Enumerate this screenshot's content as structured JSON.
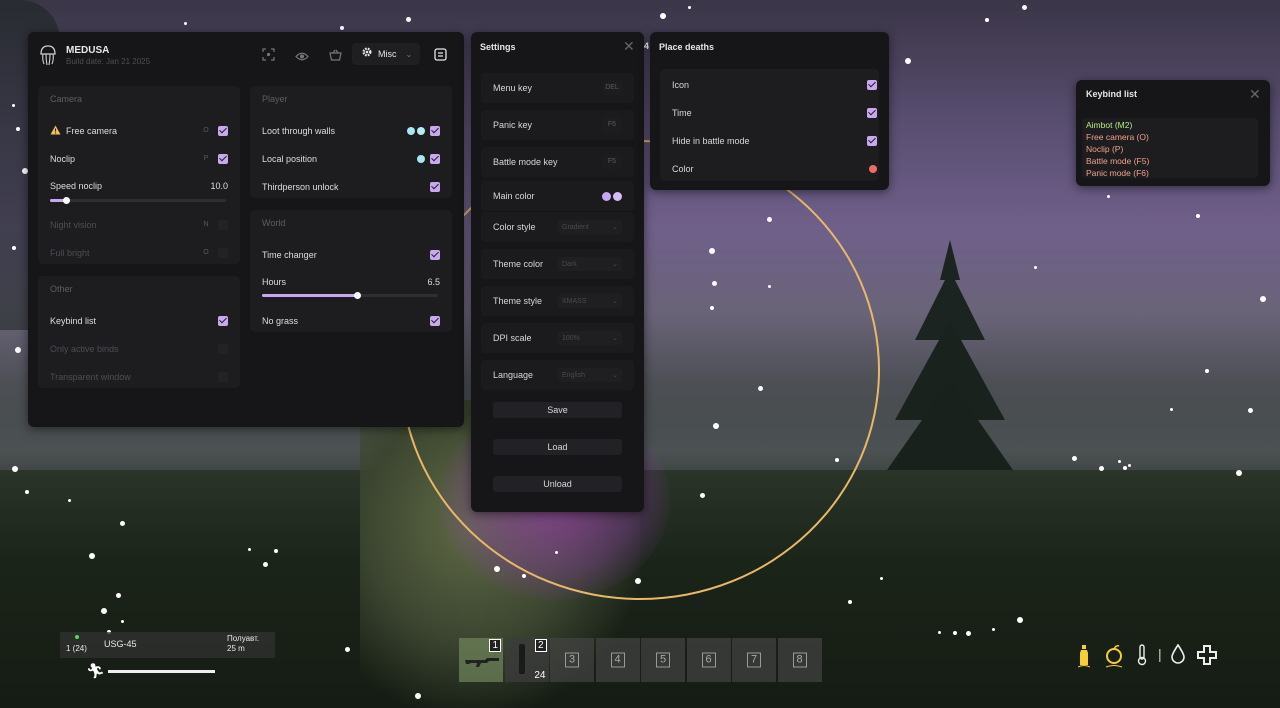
{
  "menu": {
    "app_name": "MEDUSA",
    "build_date": "Build date: Jan 21 2025",
    "toolbar": {
      "tab_label": "Misc"
    },
    "camera": {
      "title": "Camera",
      "free_camera": {
        "label": "Free camera",
        "key": "O"
      },
      "noclip": {
        "label": "Noclip",
        "key": "P"
      },
      "speed_noclip": {
        "label": "Speed noclip",
        "value": "10.0",
        "fraction": 0.09
      },
      "night_vision": {
        "label": "Night vision",
        "key": "N"
      },
      "full_bright": {
        "label": "Full bright",
        "key": "O"
      }
    },
    "other": {
      "title": "Other",
      "keybind_list": "Keybind list",
      "only_active_binds": "Only active binds",
      "transparent_window": "Transparent window"
    },
    "player": {
      "title": "Player",
      "loot_through_walls": "Loot through walls",
      "local_position": "Local position",
      "thirdperson_unlock": "Thirdperson unlock"
    },
    "world": {
      "title": "World",
      "time_changer": "Time changer",
      "hours": {
        "label": "Hours",
        "value": "6.5",
        "fraction": 0.54
      },
      "no_grass": "No grass"
    }
  },
  "settings": {
    "title": "Settings",
    "menu_key": {
      "label": "Menu key",
      "value": "DEL"
    },
    "panic_key": {
      "label": "Panic key",
      "value": "F6"
    },
    "battle_mode_key": {
      "label": "Battle mode key",
      "value": "F5"
    },
    "main_color": "Main color",
    "color_style": {
      "label": "Color style",
      "value": "Gradient"
    },
    "theme_color": {
      "label": "Theme color",
      "value": "Dark"
    },
    "theme_style": {
      "label": "Theme style",
      "value": "XMASS"
    },
    "dpi_scale": {
      "label": "DPI scale",
      "value": "100%"
    },
    "language": {
      "label": "Language",
      "value": "English"
    },
    "save": "Save",
    "load": "Load",
    "unload": "Unload"
  },
  "place_deaths": {
    "title": "Place deaths",
    "icon": "Icon",
    "time": "Time",
    "hide_in_battle_mode": "Hide in battle mode",
    "color": "Color"
  },
  "keybind_list": {
    "title": "Keybind list",
    "items": [
      {
        "label": "Aimbot (M2)",
        "color": "#b8e986"
      },
      {
        "label": "Free camera (O)",
        "color": "#f2a08a"
      },
      {
        "label": "Noclip (P)",
        "color": "#f2a08a"
      },
      {
        "label": "Battle mode (F5)",
        "color": "#f2a08a"
      },
      {
        "label": "Panic mode (F6)",
        "color": "#f2a08a"
      }
    ]
  },
  "hud": {
    "ammo": "1 (24)",
    "weapon": "USG-45",
    "fire_mode": "Полуавт.",
    "range": "25 m",
    "stray_digit": "4",
    "slots": [
      "1",
      "2",
      "3",
      "4",
      "5",
      "6",
      "7",
      "8"
    ],
    "slot2_count": "24",
    "stamina_fraction": 1.0
  },
  "colors": {
    "accent": "#c9a8f0",
    "accent_cyan": "#a8e6f0",
    "death_color": "#f06a6a",
    "circle": "#e8b86a"
  }
}
